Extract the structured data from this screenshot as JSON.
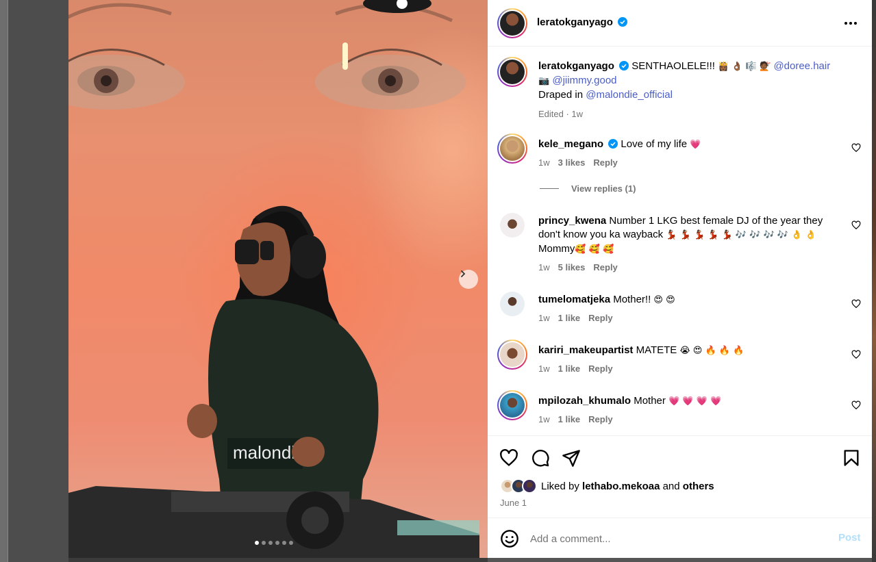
{
  "post": {
    "author": "leratokganyago",
    "media": {
      "shirt_text": "malondi",
      "slide_count": 6,
      "active_slide": 1
    },
    "caption": {
      "username": "leratokganyago",
      "text_start": "SENTHAOLELE!!!",
      "emojis_1": "👸🏾 👌🏾 🎼 💇🏾",
      "mention_1": "@doree.hair",
      "camera_emoji": "📷",
      "mention_2": "@jiimmy.good",
      "draped_text": "Draped in",
      "mention_3": "@malondie_official",
      "meta": "Edited · 1w"
    },
    "comments": [
      {
        "username": "kele_megano",
        "verified": true,
        "text": "Love of my life",
        "emoji": "💗",
        "time": "1w",
        "likes": "3 likes",
        "reply": "Reply",
        "view_replies": "View replies (1)"
      },
      {
        "username": "princy_kwena",
        "verified": false,
        "text": "Number 1 LKG best female DJ of the year they don't know you ka wayback",
        "emoji": "💃🏾 💃🏾 💃🏾 💃🏾 💃🏾 🎶 🎶 🎶 🎶 👌 👌",
        "text_end": "Mommy",
        "emoji_end": "🥰 🥰 🥰",
        "lead_emoji": "👌",
        "time": "1w",
        "likes": "5 likes",
        "reply": "Reply"
      },
      {
        "username": "tumelomatjeka",
        "verified": false,
        "text": "Mother!!",
        "emoji": "😍 😍",
        "time": "1w",
        "likes": "1 like",
        "reply": "Reply"
      },
      {
        "username": "kariri_makeupartist",
        "verified": false,
        "text": "MATETE",
        "emoji": "😭 😍 🔥 🔥 🔥",
        "time": "1w",
        "likes": "1 like",
        "reply": "Reply"
      },
      {
        "username": "mpilozah_khumalo",
        "verified": false,
        "text": "Mother",
        "emoji": "💗 💗 💗 💗",
        "time": "1w",
        "likes": "1 like",
        "reply": "Reply"
      }
    ],
    "liked_by": {
      "prefix": "Liked by",
      "user": "lethabo.mekoaa",
      "and": "and",
      "others": "others"
    },
    "date": "June 1",
    "add_comment": {
      "placeholder": "Add a comment...",
      "post": "Post"
    }
  },
  "colors": {
    "mention": "#4a5dc8",
    "verified": "#0095f6",
    "post_disabled": "#b2dffc",
    "like_heart": "#ed4956"
  },
  "icons": [
    "more-icon",
    "verified-icon",
    "heart-icon",
    "comment-icon",
    "share-icon",
    "bookmark-icon",
    "emoji-icon",
    "chevron-right-icon"
  ]
}
